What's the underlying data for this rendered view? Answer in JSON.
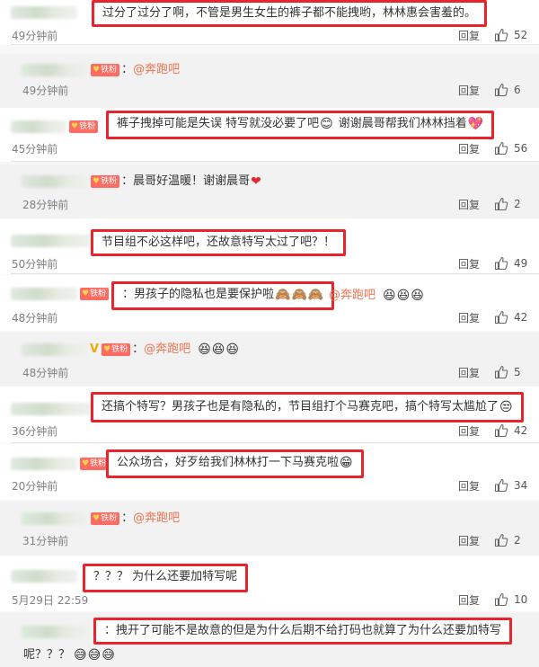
{
  "reply_label": "回复",
  "fan_badge_label": "铁粉",
  "mention": "@奔跑吧",
  "colors": {
    "highlight_box": "#e8242c",
    "mention": "#eb7350",
    "badge": "#fe6b63"
  },
  "comments": [
    {
      "text": "过分了过分了啊，不管是男生女生的裤子都不能拽哟，林林惠会害羞的。",
      "time": "49分钟前",
      "likes": "52"
    },
    {
      "time": "49分钟前",
      "likes": "6"
    },
    {
      "text": "裤子拽掉可能是失误 特写就没必要了吧",
      "text2": "谢谢晨哥帮我们林林挡着",
      "time": "45分钟前",
      "likes": "56"
    },
    {
      "text": "晨哥好温暖！谢谢晨哥",
      "time": "28分钟前",
      "likes": "2"
    },
    {
      "text": "节目组不必这样吧，还故意特写太过了吧？！",
      "time": "50分钟前",
      "likes": "49"
    },
    {
      "text": "男孩子的隐私也是要保护啦",
      "time": "48分钟前",
      "likes": "42"
    },
    {
      "time": "48分钟前",
      "likes": "5"
    },
    {
      "text": "还搞个特写？男孩子也是有隐私的，节目组打个马赛克吧，搞个特写太尴尬了",
      "time": "36分钟前",
      "likes": "42"
    },
    {
      "text": "公众场合，好歹给我们林林打一下马赛克啦",
      "time": "20分钟前",
      "likes": "34"
    },
    {
      "time": "31分钟前",
      "likes": "2"
    },
    {
      "text": "？？？ 为什么还要加特写呢",
      "time": "5月29日 22:59",
      "likes": "10"
    },
    {
      "text": "拽开了可能不是故意的但是为什么后期不给打码也就算了为什么还要加特写",
      "text2": "呢？？？",
      "likes": ""
    }
  ]
}
